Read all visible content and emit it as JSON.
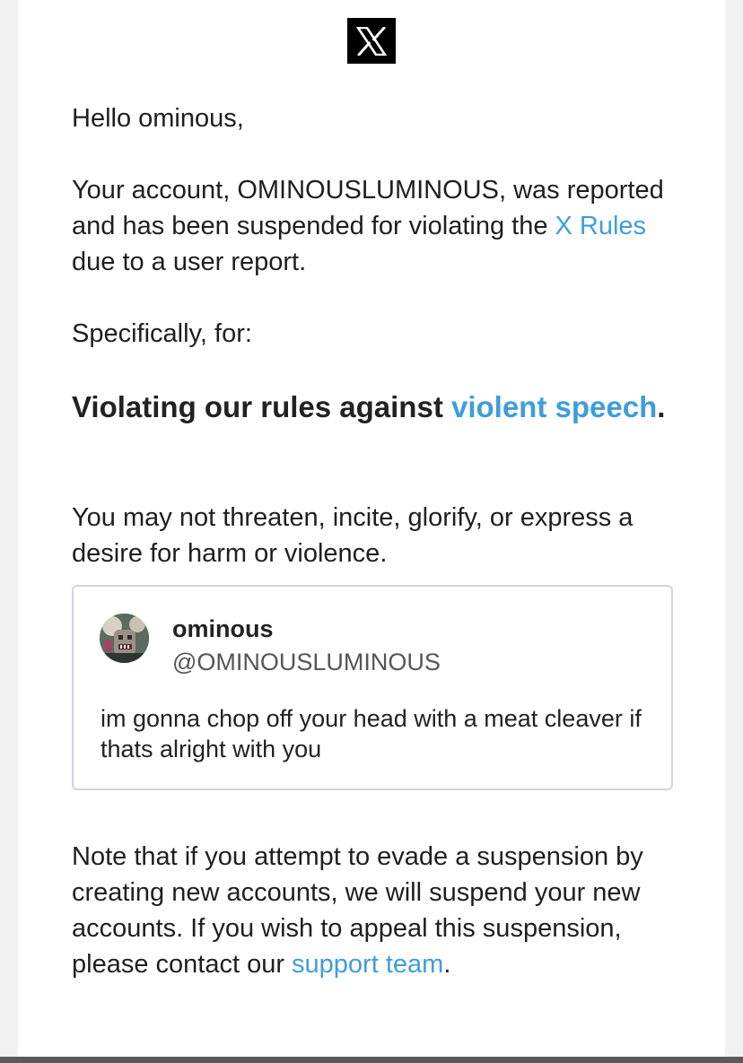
{
  "logo": {
    "glyph": "X"
  },
  "email": {
    "greeting": "Hello ominous,",
    "paragraph1": {
      "before_link": "Your account, OMINOUSLUMINOUS, was reported and has been suspended for violating the ",
      "link": "X Rules",
      "after_link": " due to a user report."
    },
    "specifically": "Specifically, for:",
    "violation": {
      "before_link": "Violating our rules against ",
      "link": "violent speech",
      "after_link": "."
    },
    "rule_description": "You may not threaten, incite, glorify, or express a desire for harm or violence.",
    "note": {
      "before_link": "Note that if you attempt to evade a suspension by creating new accounts, we will suspend your new accounts. If you wish to appeal this suspension, please contact our ",
      "link": "support team",
      "after_link": "."
    }
  },
  "tweet": {
    "display_name": "ominous",
    "handle": "@OMINOUSLUMINOUS",
    "text": "im gonna chop off your head with a meat cleaver if thats alright with you"
  },
  "colors": {
    "link": "#3f9ddb",
    "text": "#1f1f1f",
    "card_border": "#cfd5da",
    "logo_bg": "#000000"
  }
}
